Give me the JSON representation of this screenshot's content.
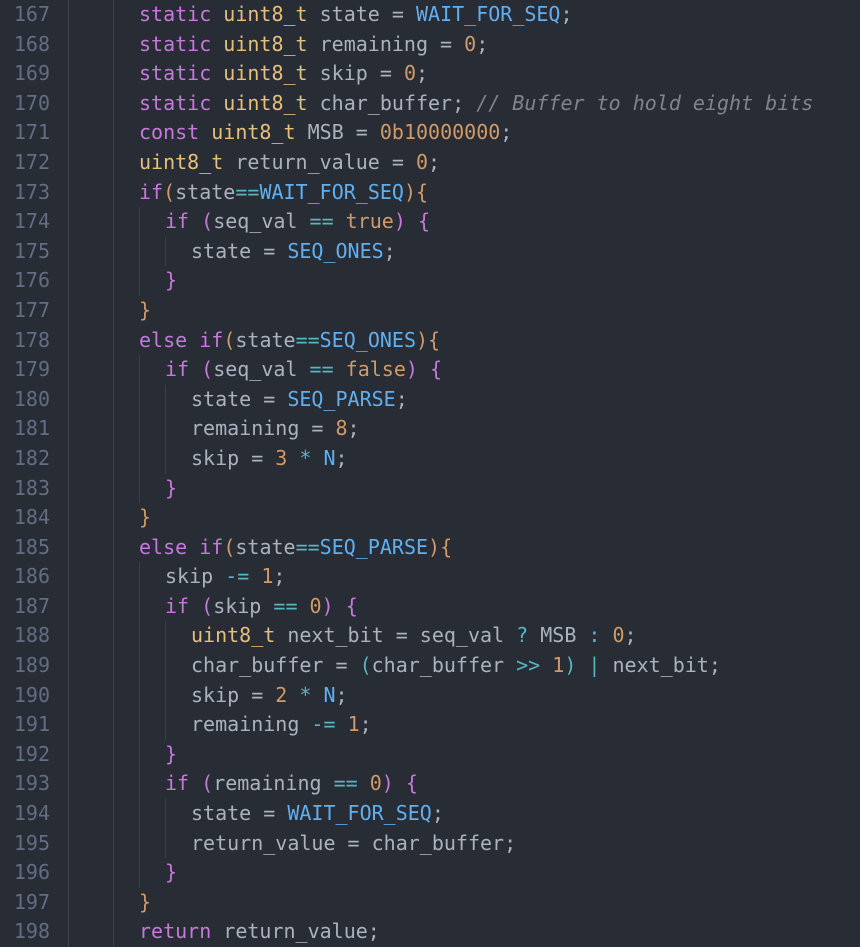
{
  "startLine": 167,
  "lines": [
    {
      "indent": 2,
      "tokens": [
        {
          "t": "static",
          "c": "kw"
        },
        {
          "t": " ",
          "c": "txt"
        },
        {
          "t": "uint8_t",
          "c": "type"
        },
        {
          "t": " ",
          "c": "txt"
        },
        {
          "t": "state",
          "c": "txt"
        },
        {
          "t": " = ",
          "c": "txt"
        },
        {
          "t": "WAIT_FOR_SEQ",
          "c": "const"
        },
        {
          "t": ";",
          "c": "txt"
        }
      ]
    },
    {
      "indent": 2,
      "tokens": [
        {
          "t": "static",
          "c": "kw"
        },
        {
          "t": " ",
          "c": "txt"
        },
        {
          "t": "uint8_t",
          "c": "type"
        },
        {
          "t": " ",
          "c": "txt"
        },
        {
          "t": "remaining",
          "c": "txt"
        },
        {
          "t": " = ",
          "c": "txt"
        },
        {
          "t": "0",
          "c": "num"
        },
        {
          "t": ";",
          "c": "txt"
        }
      ]
    },
    {
      "indent": 2,
      "tokens": [
        {
          "t": "static",
          "c": "kw"
        },
        {
          "t": " ",
          "c": "txt"
        },
        {
          "t": "uint8_t",
          "c": "type"
        },
        {
          "t": " ",
          "c": "txt"
        },
        {
          "t": "skip",
          "c": "txt"
        },
        {
          "t": " = ",
          "c": "txt"
        },
        {
          "t": "0",
          "c": "num"
        },
        {
          "t": ";",
          "c": "txt"
        }
      ]
    },
    {
      "indent": 2,
      "tokens": [
        {
          "t": "static",
          "c": "kw"
        },
        {
          "t": " ",
          "c": "txt"
        },
        {
          "t": "uint8_t",
          "c": "type"
        },
        {
          "t": " ",
          "c": "txt"
        },
        {
          "t": "char_buffer",
          "c": "txt"
        },
        {
          "t": "; ",
          "c": "txt"
        },
        {
          "t": "// Buffer to hold eight bits",
          "c": "cmt"
        }
      ]
    },
    {
      "indent": 2,
      "tokens": [
        {
          "t": "const",
          "c": "kw"
        },
        {
          "t": " ",
          "c": "txt"
        },
        {
          "t": "uint8_t",
          "c": "type"
        },
        {
          "t": " ",
          "c": "txt"
        },
        {
          "t": "MSB",
          "c": "txt"
        },
        {
          "t": " = ",
          "c": "txt"
        },
        {
          "t": "0b10000000",
          "c": "num"
        },
        {
          "t": ";",
          "c": "txt"
        }
      ]
    },
    {
      "indent": 2,
      "tokens": [
        {
          "t": "uint8_t",
          "c": "type"
        },
        {
          "t": " ",
          "c": "txt"
        },
        {
          "t": "return_value",
          "c": "txt"
        },
        {
          "t": " = ",
          "c": "txt"
        },
        {
          "t": "0",
          "c": "num"
        },
        {
          "t": ";",
          "c": "txt"
        }
      ]
    },
    {
      "indent": 2,
      "tokens": [
        {
          "t": "if",
          "c": "kw"
        },
        {
          "t": "(",
          "c": "brkt"
        },
        {
          "t": "state",
          "c": "txt"
        },
        {
          "t": "==",
          "c": "cyan"
        },
        {
          "t": "WAIT_FOR_SEQ",
          "c": "const"
        },
        {
          "t": ")",
          "c": "brkt"
        },
        {
          "t": "{",
          "c": "brkt"
        }
      ]
    },
    {
      "indent": 3,
      "tokens": [
        {
          "t": "if",
          "c": "kw"
        },
        {
          "t": " ",
          "c": "txt"
        },
        {
          "t": "(",
          "c": "brkt2"
        },
        {
          "t": "seq_val",
          "c": "txt"
        },
        {
          "t": " ",
          "c": "txt"
        },
        {
          "t": "==",
          "c": "cyan"
        },
        {
          "t": " ",
          "c": "txt"
        },
        {
          "t": "true",
          "c": "num"
        },
        {
          "t": ")",
          "c": "brkt2"
        },
        {
          "t": " ",
          "c": "txt"
        },
        {
          "t": "{",
          "c": "brkt2"
        }
      ]
    },
    {
      "indent": 4,
      "tokens": [
        {
          "t": "state",
          "c": "txt"
        },
        {
          "t": " = ",
          "c": "txt"
        },
        {
          "t": "SEQ_ONES",
          "c": "const"
        },
        {
          "t": ";",
          "c": "txt"
        }
      ]
    },
    {
      "indent": 3,
      "tokens": [
        {
          "t": "}",
          "c": "brkt2"
        }
      ]
    },
    {
      "indent": 2,
      "tokens": [
        {
          "t": "}",
          "c": "brkt"
        }
      ]
    },
    {
      "indent": 2,
      "tokens": [
        {
          "t": "else",
          "c": "kw"
        },
        {
          "t": " ",
          "c": "txt"
        },
        {
          "t": "if",
          "c": "kw"
        },
        {
          "t": "(",
          "c": "brkt"
        },
        {
          "t": "state",
          "c": "txt"
        },
        {
          "t": "==",
          "c": "cyan"
        },
        {
          "t": "SEQ_ONES",
          "c": "const"
        },
        {
          "t": ")",
          "c": "brkt"
        },
        {
          "t": "{",
          "c": "brkt"
        }
      ]
    },
    {
      "indent": 3,
      "tokens": [
        {
          "t": "if",
          "c": "kw"
        },
        {
          "t": " ",
          "c": "txt"
        },
        {
          "t": "(",
          "c": "brkt2"
        },
        {
          "t": "seq_val",
          "c": "txt"
        },
        {
          "t": " ",
          "c": "txt"
        },
        {
          "t": "==",
          "c": "cyan"
        },
        {
          "t": " ",
          "c": "txt"
        },
        {
          "t": "false",
          "c": "num"
        },
        {
          "t": ")",
          "c": "brkt2"
        },
        {
          "t": " ",
          "c": "txt"
        },
        {
          "t": "{",
          "c": "brkt2"
        }
      ]
    },
    {
      "indent": 4,
      "tokens": [
        {
          "t": "state",
          "c": "txt"
        },
        {
          "t": " = ",
          "c": "txt"
        },
        {
          "t": "SEQ_PARSE",
          "c": "const"
        },
        {
          "t": ";",
          "c": "txt"
        }
      ]
    },
    {
      "indent": 4,
      "tokens": [
        {
          "t": "remaining",
          "c": "txt"
        },
        {
          "t": " = ",
          "c": "txt"
        },
        {
          "t": "8",
          "c": "num"
        },
        {
          "t": ";",
          "c": "txt"
        }
      ]
    },
    {
      "indent": 4,
      "tokens": [
        {
          "t": "skip",
          "c": "txt"
        },
        {
          "t": " = ",
          "c": "txt"
        },
        {
          "t": "3",
          "c": "num"
        },
        {
          "t": " ",
          "c": "txt"
        },
        {
          "t": "*",
          "c": "cyan"
        },
        {
          "t": " ",
          "c": "txt"
        },
        {
          "t": "N",
          "c": "const"
        },
        {
          "t": ";",
          "c": "txt"
        }
      ]
    },
    {
      "indent": 3,
      "tokens": [
        {
          "t": "}",
          "c": "brkt2"
        }
      ]
    },
    {
      "indent": 2,
      "tokens": [
        {
          "t": "}",
          "c": "brkt"
        }
      ]
    },
    {
      "indent": 2,
      "tokens": [
        {
          "t": "else",
          "c": "kw"
        },
        {
          "t": " ",
          "c": "txt"
        },
        {
          "t": "if",
          "c": "kw"
        },
        {
          "t": "(",
          "c": "brkt"
        },
        {
          "t": "state",
          "c": "txt"
        },
        {
          "t": "==",
          "c": "cyan"
        },
        {
          "t": "SEQ_PARSE",
          "c": "const"
        },
        {
          "t": ")",
          "c": "brkt"
        },
        {
          "t": "{",
          "c": "brkt"
        }
      ]
    },
    {
      "indent": 3,
      "tokens": [
        {
          "t": "skip",
          "c": "txt"
        },
        {
          "t": " ",
          "c": "txt"
        },
        {
          "t": "-=",
          "c": "cyan"
        },
        {
          "t": " ",
          "c": "txt"
        },
        {
          "t": "1",
          "c": "num"
        },
        {
          "t": ";",
          "c": "txt"
        }
      ]
    },
    {
      "indent": 3,
      "tokens": [
        {
          "t": "if",
          "c": "kw"
        },
        {
          "t": " ",
          "c": "txt"
        },
        {
          "t": "(",
          "c": "brkt2"
        },
        {
          "t": "skip",
          "c": "txt"
        },
        {
          "t": " ",
          "c": "txt"
        },
        {
          "t": "==",
          "c": "cyan"
        },
        {
          "t": " ",
          "c": "txt"
        },
        {
          "t": "0",
          "c": "num"
        },
        {
          "t": ")",
          "c": "brkt2"
        },
        {
          "t": " ",
          "c": "txt"
        },
        {
          "t": "{",
          "c": "brkt2"
        }
      ]
    },
    {
      "indent": 4,
      "tokens": [
        {
          "t": "uint8_t",
          "c": "type"
        },
        {
          "t": " ",
          "c": "txt"
        },
        {
          "t": "next_bit",
          "c": "txt"
        },
        {
          "t": " = ",
          "c": "txt"
        },
        {
          "t": "seq_val",
          "c": "txt"
        },
        {
          "t": " ",
          "c": "txt"
        },
        {
          "t": "?",
          "c": "cyan"
        },
        {
          "t": " ",
          "c": "txt"
        },
        {
          "t": "MSB",
          "c": "txt"
        },
        {
          "t": " ",
          "c": "txt"
        },
        {
          "t": ":",
          "c": "cyan"
        },
        {
          "t": " ",
          "c": "txt"
        },
        {
          "t": "0",
          "c": "num"
        },
        {
          "t": ";",
          "c": "txt"
        }
      ]
    },
    {
      "indent": 4,
      "tokens": [
        {
          "t": "char_buffer",
          "c": "txt"
        },
        {
          "t": " = ",
          "c": "txt"
        },
        {
          "t": "(",
          "c": "brkt3"
        },
        {
          "t": "char_buffer",
          "c": "txt"
        },
        {
          "t": " ",
          "c": "txt"
        },
        {
          "t": ">>",
          "c": "cyan"
        },
        {
          "t": " ",
          "c": "txt"
        },
        {
          "t": "1",
          "c": "num"
        },
        {
          "t": ")",
          "c": "brkt3"
        },
        {
          "t": " ",
          "c": "txt"
        },
        {
          "t": "|",
          "c": "cyan"
        },
        {
          "t": " ",
          "c": "txt"
        },
        {
          "t": "next_bit",
          "c": "txt"
        },
        {
          "t": ";",
          "c": "txt"
        }
      ]
    },
    {
      "indent": 4,
      "tokens": [
        {
          "t": "skip",
          "c": "txt"
        },
        {
          "t": " = ",
          "c": "txt"
        },
        {
          "t": "2",
          "c": "num"
        },
        {
          "t": " ",
          "c": "txt"
        },
        {
          "t": "*",
          "c": "cyan"
        },
        {
          "t": " ",
          "c": "txt"
        },
        {
          "t": "N",
          "c": "const"
        },
        {
          "t": ";",
          "c": "txt"
        }
      ]
    },
    {
      "indent": 4,
      "tokens": [
        {
          "t": "remaining",
          "c": "txt"
        },
        {
          "t": " ",
          "c": "txt"
        },
        {
          "t": "-=",
          "c": "cyan"
        },
        {
          "t": " ",
          "c": "txt"
        },
        {
          "t": "1",
          "c": "num"
        },
        {
          "t": ";",
          "c": "txt"
        }
      ]
    },
    {
      "indent": 3,
      "tokens": [
        {
          "t": "}",
          "c": "brkt2"
        }
      ]
    },
    {
      "indent": 3,
      "tokens": [
        {
          "t": "if",
          "c": "kw"
        },
        {
          "t": " ",
          "c": "txt"
        },
        {
          "t": "(",
          "c": "brkt2"
        },
        {
          "t": "remaining",
          "c": "txt"
        },
        {
          "t": " ",
          "c": "txt"
        },
        {
          "t": "==",
          "c": "cyan"
        },
        {
          "t": " ",
          "c": "txt"
        },
        {
          "t": "0",
          "c": "num"
        },
        {
          "t": ")",
          "c": "brkt2"
        },
        {
          "t": " ",
          "c": "txt"
        },
        {
          "t": "{",
          "c": "brkt2"
        }
      ]
    },
    {
      "indent": 4,
      "tokens": [
        {
          "t": "state",
          "c": "txt"
        },
        {
          "t": " = ",
          "c": "txt"
        },
        {
          "t": "WAIT_FOR_SEQ",
          "c": "const"
        },
        {
          "t": ";",
          "c": "txt"
        }
      ]
    },
    {
      "indent": 4,
      "tokens": [
        {
          "t": "return_value",
          "c": "txt"
        },
        {
          "t": " = ",
          "c": "txt"
        },
        {
          "t": "char_buffer",
          "c": "txt"
        },
        {
          "t": ";",
          "c": "txt"
        }
      ]
    },
    {
      "indent": 3,
      "tokens": [
        {
          "t": "}",
          "c": "brkt2"
        }
      ]
    },
    {
      "indent": 2,
      "tokens": [
        {
          "t": "}",
          "c": "brkt"
        }
      ]
    },
    {
      "indent": 2,
      "tokens": [
        {
          "t": "return",
          "c": "kw"
        },
        {
          "t": " ",
          "c": "txt"
        },
        {
          "t": "return_value",
          "c": "txt"
        },
        {
          "t": ";",
          "c": "txt"
        }
      ]
    }
  ]
}
